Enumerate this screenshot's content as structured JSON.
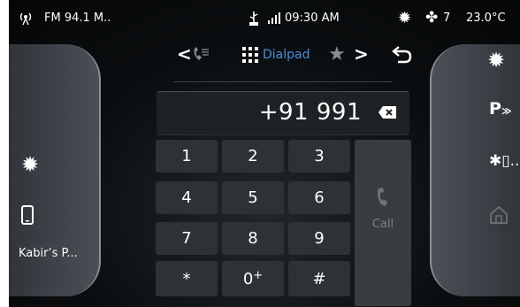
{
  "status": {
    "radio_label": "FM  94.1 M..",
    "time": "09:30 AM",
    "fan_level": "7",
    "temperature": "23.0°C"
  },
  "left_panel": {
    "phone_name": "Kabir’s P..."
  },
  "tabs": {
    "current": "Dialpad"
  },
  "display": {
    "number": "+91 991"
  },
  "keypad": {
    "keys": [
      "1",
      "2",
      "3",
      "4",
      "5",
      "6",
      "7",
      "8",
      "9",
      "*",
      "0",
      "#"
    ],
    "zero_superscript": "+"
  },
  "call_button": {
    "label": "Call"
  },
  "colors": {
    "accent": "#4a8bd8",
    "background": "#0b0e10",
    "key": "#2f3235"
  },
  "icons": {
    "radio": "radio-icon",
    "usb": "usb-icon",
    "signal": "signal-icon",
    "climate": "climate-icon",
    "fan": "fan-icon",
    "settings": "gear-icon",
    "phone": "phone-icon",
    "call_log": "call-log-icon",
    "dialpad": "dialpad-grid-icon",
    "favorites": "star-icon",
    "back": "back-icon",
    "backspace": "backspace-icon",
    "parking": "parking-icon",
    "bluetooth": "bluetooth-icon",
    "home": "home-icon"
  }
}
